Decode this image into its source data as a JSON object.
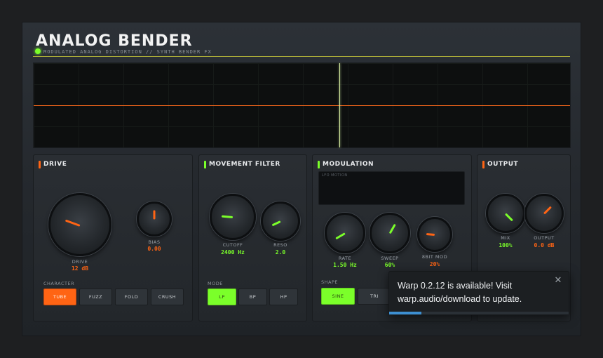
{
  "header": {
    "title": "ANALOG BENDER",
    "subtitle": "MODULATED ANALOG DISTORTION // SYNTH BENDER FX"
  },
  "colors": {
    "orange": "#ff6414",
    "green": "#7bff2a",
    "bg": "#24282d"
  },
  "drive": {
    "title": "DRIVE",
    "drive_knob": {
      "label": "DRIVE",
      "value": "12 dB"
    },
    "bias_knob": {
      "label": "BIAS",
      "value": "0.00"
    },
    "character_label": "CHARACTER",
    "buttons": [
      "TUBE",
      "FUZZ",
      "FOLD",
      "CRUSH"
    ],
    "selected": "TUBE"
  },
  "filter": {
    "title": "MOVEMENT FILTER",
    "cutoff_knob": {
      "label": "CUTOFF",
      "value": "2400 Hz"
    },
    "reso_knob": {
      "label": "RESO",
      "value": "2.0"
    },
    "mode_label": "MODE",
    "buttons": [
      "LP",
      "BP",
      "HP"
    ],
    "selected": "LP"
  },
  "modulation": {
    "title": "MODULATION",
    "lfo_label": "LFO MOTION",
    "rate_knob": {
      "label": "RATE",
      "value": "1.50 Hz"
    },
    "sweep_knob": {
      "label": "SWEEP",
      "value": "60%"
    },
    "bitmod_knob": {
      "label": "8BIT MOD",
      "value": "20%"
    },
    "shape_label": "SHAPE",
    "buttons": [
      "SINE",
      "TRI"
    ],
    "selected": "SINE"
  },
  "output": {
    "title": "OUTPUT",
    "mix_knob": {
      "label": "MIX",
      "value": "100%"
    },
    "output_knob": {
      "label": "OUTPUT",
      "value": "0.0 dB"
    }
  },
  "toast": {
    "message": "Warp 0.2.12 is available! Visit warp.audio/download to update.",
    "close_icon": "close-icon",
    "progress_fraction": 0.18
  }
}
